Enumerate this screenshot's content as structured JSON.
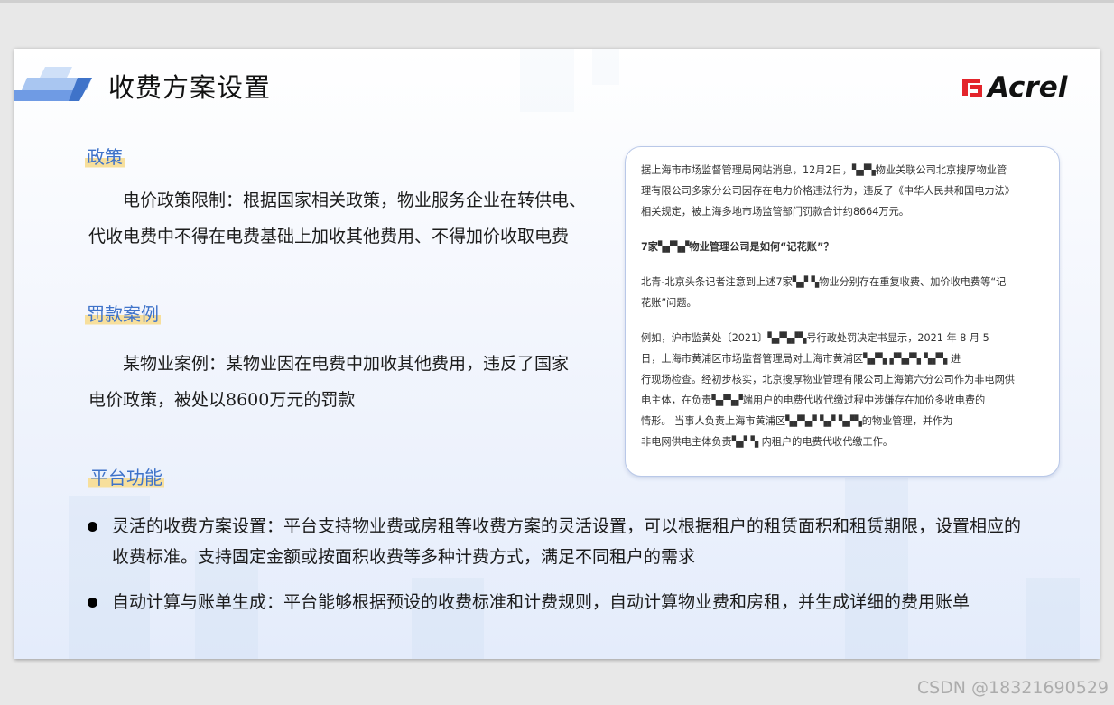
{
  "slide": {
    "title": "收费方案设置",
    "logo_text": "Acrel",
    "logo_color": "#e3242b",
    "accent": "#3f73c9",
    "highlight": "#f7df9c"
  },
  "sections": {
    "policy": {
      "heading": "政策",
      "lines": [
        "电价政策限制：根据国家相关政策，物业服务企业在转供电、",
        "代收电费中不得在电费基础上加收其他费用、不得加价收取电费"
      ]
    },
    "penalty": {
      "heading": "罚款案例",
      "lines": [
        "某物业案例：某物业因在电费中加收其他费用，违反了国家",
        "电价政策，被处以8600万元的罚款"
      ]
    },
    "platform": {
      "heading": "平台功能",
      "bullets": [
        {
          "lines": [
            "灵活的收费方案设置：平台支持物业费或房租等收费方案的灵活设置，可以根据租户的租赁面积和租赁期限，设置相应的",
            "收费标准。支持固定金额或按面积收费等多种计费方式，满足不同租户的需求"
          ]
        },
        {
          "lines": [
            "自动计算与账单生成：平台能够根据预设的收费标准和计费规则，自动计算物业费和房租，并生成详细的费用账单"
          ]
        }
      ]
    }
  },
  "news": {
    "p1": [
      "据上海市市场监督管理局网站消息，12月2日，▚▞▚物业关联公司北京搜厚物业管",
      "理有限公司多家分公司因存在电力价格违法行为，违反了《中华人民共和国电力法》",
      "相关规定，被上海多地市场监管部门罚款合计约8664万元。"
    ],
    "p2": [
      "7家▚▞▚▞物业管理公司是如何“记花账”？"
    ],
    "p3": [
      "北青-北京头条记者注意到上述7家▚▞ ▚物业分别存在重复收费、加价收电费等“记",
      "花账”问题。"
    ],
    "p4": [
      "例如，沪市监黄处〔2021〕▚▞▚▞▚号行政处罚决定书显示，2021 年 8 月 5",
      "日，上海市黄浦区市场监督管理局对上海市黄浦区▚▞▚ ▞▚▞▚ ▚▞▚ 进",
      "行现场检查。经初步核实，北京搜厚物业管理有限公司上海第六分公司作为非电网供",
      "电主体，在负责▚▞▚▞端用户的电费代收代缴过程中涉嫌存在加价多收电费的",
      "情形。 当事人负责上海市黄浦区▚▞▚▞ ▚▞ ▚▞▚的物业管理，并作为",
      "非电网供电主体负责▚▞ ▚ 内租户的电费代收代缴工作。"
    ]
  },
  "watermark": "CSDN @18321690529"
}
